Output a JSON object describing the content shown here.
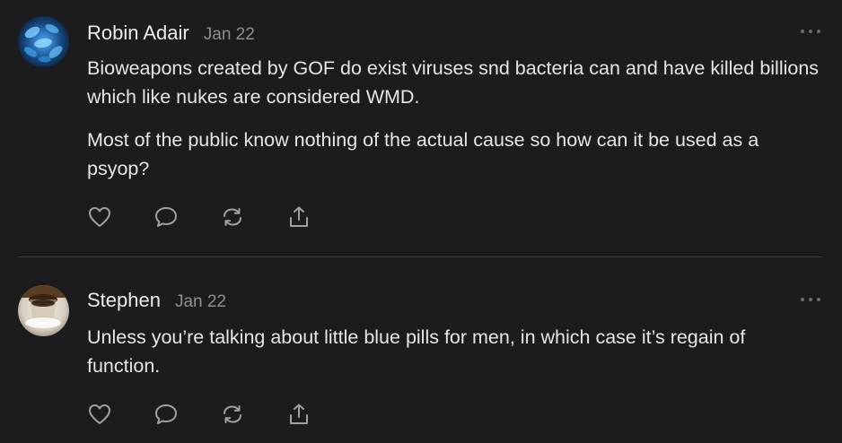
{
  "comments": [
    {
      "author": "Robin Adair",
      "date": "Jan 22",
      "paragraphs": [
        "Bioweapons created by GOF do exist viruses snd bacteria can and have killed billions which like nukes are considered WMD.",
        "Most of the public know nothing of the actual cause so how can it be used as a psyop?"
      ],
      "actions": [
        "heart-icon",
        "comment-icon",
        "restack-icon",
        "share-icon"
      ]
    },
    {
      "author": "Stephen",
      "date": "Jan 22",
      "paragraphs": [
        "Unless you’re talking about little blue pills for men, in which case it’s regain of function."
      ],
      "actions": [
        "heart-icon",
        "comment-icon",
        "restack-icon",
        "share-icon"
      ]
    }
  ],
  "colors": {
    "background": "#1c1c1e",
    "text": "#e6e6e8",
    "muted": "#8e8e93",
    "icon": "#a0a0a5",
    "divider": "#3a3a3c"
  }
}
